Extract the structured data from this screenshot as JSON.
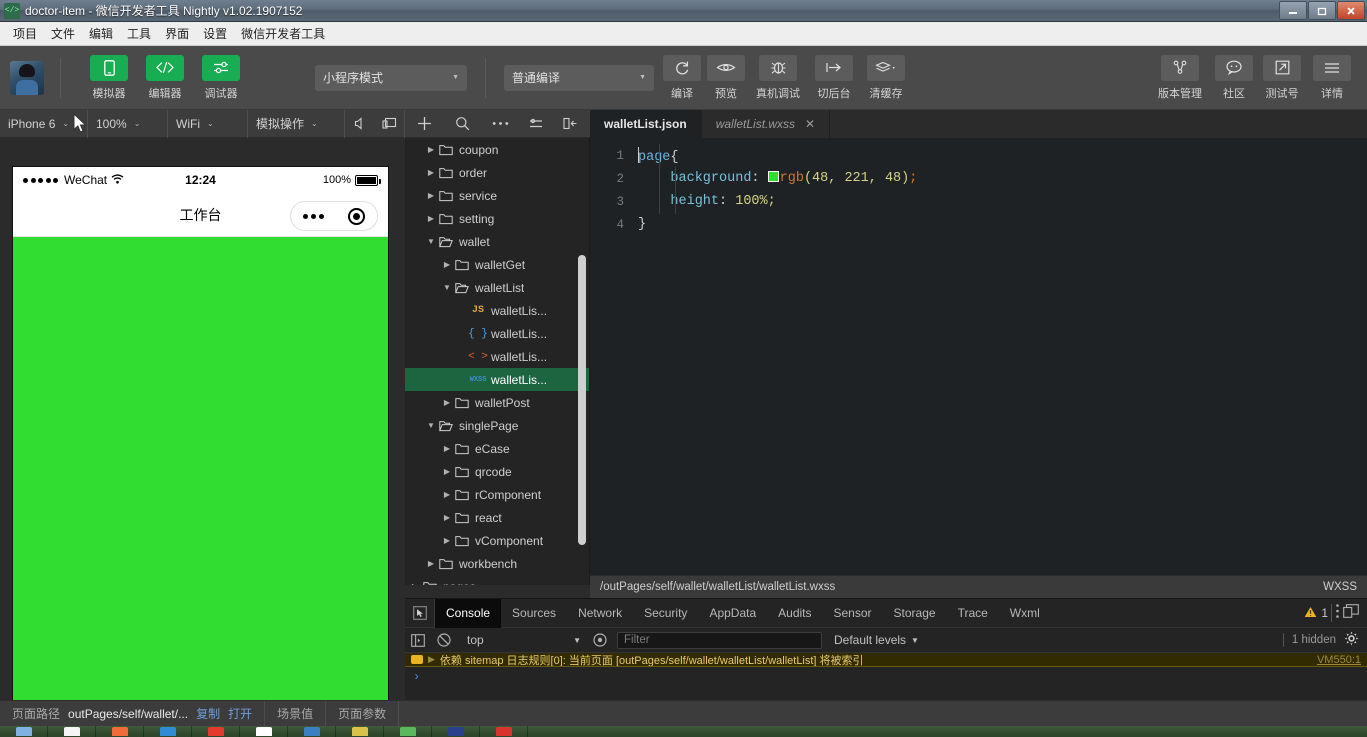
{
  "window": {
    "title": "doctor-item - 微信开发者工具 Nightly v1.02.1907152",
    "app_icon": "code-icon",
    "controls": {
      "minimize": "minimize-icon",
      "maximize": "maximize-icon",
      "close": "close-icon"
    }
  },
  "menubar": {
    "items": [
      {
        "label": "项目"
      },
      {
        "label": "文件"
      },
      {
        "label": "编辑"
      },
      {
        "label": "工具"
      },
      {
        "label": "界面"
      },
      {
        "label": "设置"
      },
      {
        "label": "微信开发者工具"
      }
    ]
  },
  "toolbar": {
    "avatar": "user-avatar",
    "panel_buttons": [
      {
        "label": "模拟器",
        "icon": "phone-icon",
        "color": "#18ad52"
      },
      {
        "label": "编辑器",
        "icon": "code-brackets-icon",
        "color": "#18ad52"
      },
      {
        "label": "调试器",
        "icon": "sliders-icon",
        "color": "#18ad52"
      }
    ],
    "mode_select": {
      "value": "小程序模式",
      "caret": "chevron-down-icon"
    },
    "compile_select": {
      "value": "普通编译",
      "caret": "chevron-down-icon"
    },
    "action_buttons": [
      {
        "label": "编译",
        "icon": "refresh-icon"
      },
      {
        "label": "预览",
        "icon": "eye-icon"
      },
      {
        "label": "真机调试",
        "icon": "bug-icon"
      },
      {
        "label": "切后台",
        "icon": "arrow-to-bar-icon"
      },
      {
        "label": "清缓存",
        "icon": "layers-icon",
        "has_caret": true
      }
    ],
    "right_buttons": [
      {
        "label": "版本管理",
        "icon": "branch-icon"
      },
      {
        "label": "社区",
        "icon": "chat-bubble-icon"
      },
      {
        "label": "测试号",
        "icon": "external-link-icon"
      },
      {
        "label": "详情",
        "icon": "hamburger-icon"
      }
    ]
  },
  "simbar": {
    "device": {
      "value": "iPhone 6",
      "caret": "chevron-down-icon"
    },
    "zoom": {
      "value": "100%",
      "caret": "chevron-down-icon"
    },
    "network": {
      "value": "WiFi",
      "caret": "chevron-down-icon"
    },
    "sim_action": {
      "value": "模拟操作",
      "caret": "chevron-down-icon"
    },
    "icons": [
      "volume-icon",
      "screen-rotate-icon",
      "plus-icon",
      "search-icon",
      "more-horizontal-icon",
      "list-settings-icon",
      "collapse-panel-icon"
    ]
  },
  "simulator": {
    "status": {
      "carrier": "WeChat",
      "signal_dots": 5,
      "wifi_icon": "wifi-icon",
      "time": "12:24",
      "battery_percent": "100%",
      "battery_icon": "battery-full-icon"
    },
    "nav": {
      "title": "工作台",
      "capsule": {
        "more_icon": "more-dots-icon",
        "target_icon": "target-circle-icon"
      }
    },
    "page_background": "#30dd30"
  },
  "file_tree": {
    "rows": [
      {
        "label": "coupon",
        "type": "folder",
        "indent": 1,
        "expanded": false,
        "selected": false
      },
      {
        "label": "order",
        "type": "folder",
        "indent": 1,
        "expanded": false,
        "selected": false
      },
      {
        "label": "service",
        "type": "folder",
        "indent": 1,
        "expanded": false,
        "selected": false
      },
      {
        "label": "setting",
        "type": "folder",
        "indent": 1,
        "expanded": false,
        "selected": false
      },
      {
        "label": "wallet",
        "type": "folder",
        "indent": 1,
        "expanded": true,
        "selected": false
      },
      {
        "label": "walletGet",
        "type": "folder",
        "indent": 2,
        "expanded": false,
        "selected": false
      },
      {
        "label": "walletList",
        "type": "folder",
        "indent": 2,
        "expanded": true,
        "selected": false
      },
      {
        "label": "walletLis...",
        "type": "js",
        "indent": 3,
        "expanded": null,
        "selected": false,
        "badge": "JS"
      },
      {
        "label": "walletLis...",
        "type": "json",
        "indent": 3,
        "expanded": null,
        "selected": false,
        "badge": "{ }"
      },
      {
        "label": "walletLis...",
        "type": "wxml",
        "indent": 3,
        "expanded": null,
        "selected": false,
        "badge": "< >"
      },
      {
        "label": "walletLis...",
        "type": "wxss",
        "indent": 3,
        "expanded": null,
        "selected": true,
        "badge": "WXSS"
      },
      {
        "label": "walletPost",
        "type": "folder",
        "indent": 2,
        "expanded": false,
        "selected": false
      },
      {
        "label": "singlePage",
        "type": "folder",
        "indent": 1,
        "expanded": true,
        "selected": false
      },
      {
        "label": "eCase",
        "type": "folder",
        "indent": 2,
        "expanded": false,
        "selected": false
      },
      {
        "label": "qrcode",
        "type": "folder",
        "indent": 2,
        "expanded": false,
        "selected": false
      },
      {
        "label": "rComponent",
        "type": "folder",
        "indent": 2,
        "expanded": false,
        "selected": false
      },
      {
        "label": "react",
        "type": "folder",
        "indent": 2,
        "expanded": false,
        "selected": false
      },
      {
        "label": "vComponent",
        "type": "folder",
        "indent": 2,
        "expanded": false,
        "selected": false
      },
      {
        "label": "workbench",
        "type": "folder",
        "indent": 1,
        "expanded": false,
        "selected": false
      },
      {
        "label": "pages",
        "type": "folder",
        "indent": 0,
        "expanded": false,
        "selected": false
      }
    ]
  },
  "editor": {
    "tabs": [
      {
        "label": "walletList.json",
        "active": true,
        "closable": false
      },
      {
        "label": "walletList.wxss",
        "active": false,
        "closable": true,
        "close_icon": "close-icon"
      }
    ],
    "lines": [
      {
        "num": "1",
        "text": "page{"
      },
      {
        "num": "2",
        "text": "    background: rgb(48, 221, 48);"
      },
      {
        "num": "3",
        "text": "    height: 100%;"
      },
      {
        "num": "4",
        "text": "}"
      }
    ],
    "tokens": {
      "l1_selector": "page",
      "l1_brace": "{",
      "l2_prop": "background",
      "l2_colon": ": ",
      "l2_fn": "rgb",
      "l2_args": "(48, 221, 48)",
      "l2_semi": ";",
      "l2_swatch_color": "rgb(48, 221, 48)",
      "l3_prop": "height",
      "l3_colon": ": ",
      "l3_val": "100%",
      "l3_semi": ";",
      "l4_brace": "}"
    }
  },
  "pathbar": {
    "path": "/outPages/self/wallet/walletList/walletList.wxss",
    "language": "WXSS"
  },
  "devtools": {
    "cursor_icon": "inspect-cursor-icon",
    "tabs": [
      {
        "label": "Console",
        "active": true
      },
      {
        "label": "Sources",
        "active": false
      },
      {
        "label": "Network",
        "active": false
      },
      {
        "label": "Security",
        "active": false
      },
      {
        "label": "AppData",
        "active": false
      },
      {
        "label": "Audits",
        "active": false
      },
      {
        "label": "Sensor",
        "active": false
      },
      {
        "label": "Storage",
        "active": false
      },
      {
        "label": "Trace",
        "active": false
      },
      {
        "label": "Wxml",
        "active": false
      }
    ],
    "warning_count": "1",
    "warning_icon": "warning-triangle-icon",
    "more_icon": "kebab-menu-icon",
    "dock_icon": "dock-panel-icon",
    "console_toolbar": {
      "sidebar_icon": "show-sidebar-icon",
      "clear_icon": "clear-console-icon",
      "context": "top",
      "context_caret": "chevron-down-icon",
      "eye_icon": "live-expression-icon",
      "filter_placeholder": "Filter",
      "levels": "Default levels",
      "levels_caret": "chevron-down-icon",
      "hidden_count": "1 hidden",
      "settings_icon": "gear-icon"
    },
    "messages": [
      {
        "level": "warning",
        "text": "依赖 sitemap 日志规则[0]: 当前页面 [outPages/self/wallet/walletList/walletList] 将被索引",
        "source": "VM550:1"
      }
    ],
    "prompt": "›"
  },
  "statusbar": {
    "page_path_label": "页面路径",
    "page_path_value": "outPages/self/wallet/...",
    "copy_label": "复制",
    "open_label": "打开",
    "scene_label": "场景值",
    "params_label": "页面参数"
  },
  "taskbar": {
    "items": [
      {
        "name": "start-orb",
        "color": "#7fb2e0"
      },
      {
        "name": "app-white",
        "color": "#f5f5f5"
      },
      {
        "name": "app-orange",
        "color": "#ef6c3a"
      },
      {
        "name": "app-blue",
        "color": "#2e8bd4"
      },
      {
        "name": "app-red-active",
        "color": "#e23b2e"
      },
      {
        "name": "app-white-2",
        "color": "#ffffff"
      },
      {
        "name": "app-blue-arrow",
        "color": "#3a7fc1"
      },
      {
        "name": "app-yellow",
        "color": "#d8c24a"
      },
      {
        "name": "app-green",
        "color": "#5cb85c"
      },
      {
        "name": "app-navy",
        "color": "#2b3f8f"
      },
      {
        "name": "app-red-2",
        "color": "#d9342b"
      }
    ]
  }
}
